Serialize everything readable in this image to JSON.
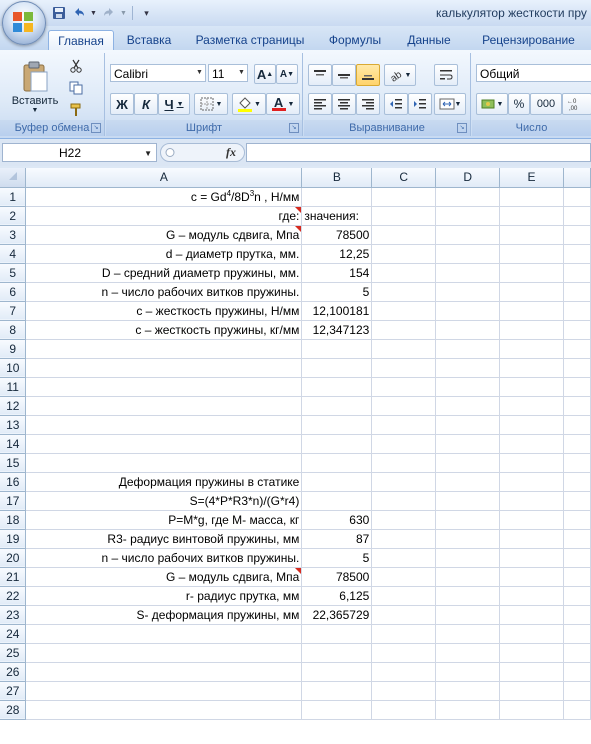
{
  "window": {
    "title": "калькулятор жесткости пру",
    "office_button_icon": "office-logo-icon"
  },
  "quick_access": [
    {
      "name": "save-icon"
    },
    {
      "name": "undo-icon"
    },
    {
      "name": "redo-icon"
    },
    {
      "name": "customize-qat-icon"
    }
  ],
  "tabs": [
    "Главная",
    "Вставка",
    "Разметка страницы",
    "Формулы",
    "Данные",
    "Рецензирование"
  ],
  "active_tab": "Главная",
  "ribbon": {
    "clipboard": {
      "label": "Буфер обмена",
      "paste_label": "Вставить"
    },
    "font": {
      "label": "Шрифт",
      "font_name": "Calibri",
      "font_size": "11",
      "bold": "Ж",
      "italic": "К",
      "underline": "Ч",
      "grow": "A",
      "shrink": "A",
      "font_color_letter": "A"
    },
    "alignment": {
      "label": "Выравнивание"
    },
    "number": {
      "label": "Число",
      "format": "Общий",
      "percent": "%",
      "thousands": "000"
    }
  },
  "formula_bar": {
    "name_box": "H22",
    "fx": "fx",
    "formula": ""
  },
  "columns": [
    "A",
    "B",
    "C",
    "D",
    "E"
  ],
  "rows": [
    {
      "n": "1",
      "a": "",
      "b": "",
      "formula_row": true
    },
    {
      "n": "2",
      "a": "где:",
      "b": "значения:",
      "comment_a": true
    },
    {
      "n": "3",
      "a": "G – модуль сдвига, Мпа",
      "b": "78500",
      "comment_a": true
    },
    {
      "n": "4",
      "a": "d – диаметр прутка, мм.",
      "b": "12,25"
    },
    {
      "n": "5",
      "a": "D – средний диаметр пружины, мм.",
      "b": "154"
    },
    {
      "n": "6",
      "a": "n – число рабочих витков пружины.",
      "b": "5"
    },
    {
      "n": "7",
      "a": "c – жесткость пружины, Н/мм",
      "b": "12,100181"
    },
    {
      "n": "8",
      "a": "c – жесткость пружины, кг/мм",
      "b": "12,347123"
    },
    {
      "n": "9",
      "a": "",
      "b": ""
    },
    {
      "n": "10",
      "a": "",
      "b": ""
    },
    {
      "n": "11",
      "a": "",
      "b": ""
    },
    {
      "n": "12",
      "a": "",
      "b": ""
    },
    {
      "n": "13",
      "a": "",
      "b": ""
    },
    {
      "n": "14",
      "a": "",
      "b": ""
    },
    {
      "n": "15",
      "a": "",
      "b": ""
    },
    {
      "n": "16",
      "a": "Деформация пружины в статике",
      "b": ""
    },
    {
      "n": "17",
      "a": "S=(4*P*R3*n)/(G*r4)",
      "b": ""
    },
    {
      "n": "18",
      "a": "P=M*g, где M- масса, кг",
      "b": "630"
    },
    {
      "n": "19",
      "a": "R3- радиус винтовой пружины, мм",
      "b": "87"
    },
    {
      "n": "20",
      "a": "n – число рабочих витков пружины.",
      "b": "5"
    },
    {
      "n": "21",
      "a": "G – модуль сдвига, Мпа",
      "b": "78500",
      "comment_a": true
    },
    {
      "n": "22",
      "a": "r- радиус прутка, мм",
      "b": "6,125"
    },
    {
      "n": "23",
      "a": "S- деформация пружины, мм",
      "b": "22,365729"
    },
    {
      "n": "24",
      "a": "",
      "b": ""
    },
    {
      "n": "25",
      "a": "",
      "b": ""
    },
    {
      "n": "26",
      "a": "",
      "b": ""
    },
    {
      "n": "27",
      "a": "",
      "b": ""
    },
    {
      "n": "28",
      "a": "",
      "b": ""
    }
  ],
  "formula_cell": {
    "p1": "c = Gd",
    "s1": "4",
    "p2": "/8D",
    "s2": "3",
    "p3": "n ,  Н/мм"
  }
}
